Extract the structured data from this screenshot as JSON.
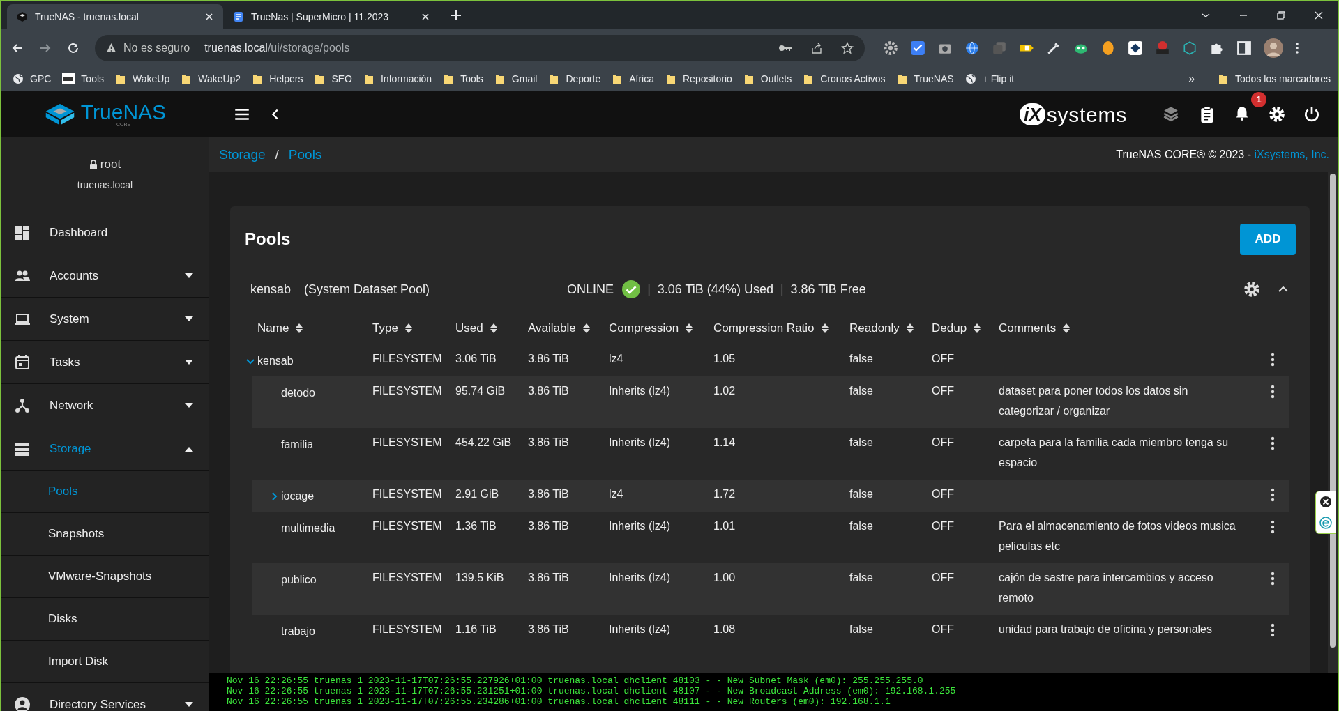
{
  "browser": {
    "tabs": [
      {
        "title": "TrueNAS - truenas.local",
        "selected": true
      },
      {
        "title": "TrueNas | SuperMicro | 11.2023",
        "selected": false
      }
    ],
    "address": {
      "warning": "No es seguro",
      "host": "truenas.local",
      "path": "/ui/storage/pools"
    },
    "bookmarks": [
      {
        "label": "GPC",
        "kind": "globe"
      },
      {
        "label": "Tools",
        "kind": "site"
      },
      {
        "label": "WakeUp",
        "kind": "folder"
      },
      {
        "label": "WakeUp2",
        "kind": "folder"
      },
      {
        "label": "Helpers",
        "kind": "folder"
      },
      {
        "label": "SEO",
        "kind": "folder"
      },
      {
        "label": "Información",
        "kind": "folder"
      },
      {
        "label": "Tools",
        "kind": "folder"
      },
      {
        "label": "Gmail",
        "kind": "folder"
      },
      {
        "label": "Deporte",
        "kind": "folder"
      },
      {
        "label": "Africa",
        "kind": "folder"
      },
      {
        "label": "Repositorio",
        "kind": "folder"
      },
      {
        "label": "Outlets",
        "kind": "folder"
      },
      {
        "label": "Cronos Activos",
        "kind": "folder"
      },
      {
        "label": "TrueNAS",
        "kind": "folder"
      },
      {
        "label": "+ Flip it",
        "kind": "globe"
      }
    ],
    "more_bookmarks": "»",
    "all_bookmarks": "Todos los marcadores"
  },
  "app_header": {
    "logo": "TrueNAS",
    "logo_sub": "CORE",
    "vendor_mark": "iX",
    "vendor_word": "systems",
    "notification_count": "1"
  },
  "sidebar": {
    "user": "root",
    "host": "truenas.local",
    "items": [
      {
        "label": "Dashboard",
        "selected": false
      },
      {
        "label": "Accounts",
        "selected": false,
        "expanded": false
      },
      {
        "label": "System",
        "selected": false,
        "expanded": false
      },
      {
        "label": "Tasks",
        "selected": false,
        "expanded": false
      },
      {
        "label": "Network",
        "selected": false,
        "expanded": false
      },
      {
        "label": "Storage",
        "selected": true,
        "expanded": true,
        "children": [
          {
            "label": "Pools",
            "selected": true
          },
          {
            "label": "Snapshots",
            "selected": false
          },
          {
            "label": "VMware-Snapshots",
            "selected": false
          },
          {
            "label": "Disks",
            "selected": false
          },
          {
            "label": "Import Disk",
            "selected": false
          }
        ]
      },
      {
        "label": "Directory Services",
        "selected": false,
        "expanded": false
      }
    ]
  },
  "breadcrumb": [
    "Storage",
    "Pools"
  ],
  "breadcrumb_separator": "/",
  "footer_credit": {
    "text": "TrueNAS CORE® © 2023 - ",
    "link": "iXsystems, Inc."
  },
  "card": {
    "title": "Pools",
    "add_button": "ADD"
  },
  "pool": {
    "name": "kensab",
    "note": "(System Dataset Pool)",
    "status": "ONLINE",
    "healthy": true,
    "separator": "|",
    "used": "3.06 TiB (44%) Used",
    "separator_2": "|",
    "free": "3.86 TiB Free",
    "expanded": true
  },
  "table": {
    "columns": [
      "Name",
      "Type",
      "Used",
      "Available",
      "Compression",
      "Compression Ratio",
      "Readonly",
      "Dedup",
      "Comments"
    ],
    "rows": [
      {
        "name": "kensab",
        "type": "FILESYSTEM",
        "used": "3.06 TiB",
        "available": "3.86 TiB",
        "compression": "lz4",
        "ratio": "1.05",
        "readonly": "false",
        "dedup": "OFF",
        "expanded": true,
        "children": [
          {
            "name": "detodo",
            "type": "FILESYSTEM",
            "used": "95.74 GiB",
            "available": "3.86 TiB",
            "compression": "Inherits (lz4)",
            "ratio": "1.02",
            "readonly": "false",
            "dedup": "OFF",
            "comments": "dataset para poner todos los datos sin categorizar / organizar"
          },
          {
            "name": "familia",
            "type": "FILESYSTEM",
            "used": "454.22 GiB",
            "available": "3.86 TiB",
            "compression": "Inherits (lz4)",
            "ratio": "1.14",
            "readonly": "false",
            "dedup": "OFF",
            "comments": "carpeta para la familia cada miembro tenga su espacio"
          },
          {
            "name": "iocage",
            "type": "FILESYSTEM",
            "used": "2.91 GiB",
            "available": "3.86 TiB",
            "compression": "lz4",
            "ratio": "1.72",
            "readonly": "false",
            "dedup": "OFF",
            "expanded": false
          },
          {
            "name": "multimedia",
            "type": "FILESYSTEM",
            "used": "1.36 TiB",
            "available": "3.86 TiB",
            "compression": "Inherits (lz4)",
            "ratio": "1.01",
            "readonly": "false",
            "dedup": "OFF",
            "comments": "Para el almacenamiento de fotos videos musica peliculas etc"
          },
          {
            "name": "publico",
            "type": "FILESYSTEM",
            "used": "139.5 KiB",
            "available": "3.86 TiB",
            "compression": "Inherits (lz4)",
            "ratio": "1.00",
            "readonly": "false",
            "dedup": "OFF",
            "comments": "cajón de sastre para intercambios y acceso remoto"
          },
          {
            "name": "trabajo",
            "type": "FILESYSTEM",
            "used": "1.16 TiB",
            "available": "3.86 TiB",
            "compression": "Inherits (lz4)",
            "ratio": "1.08",
            "readonly": "false",
            "dedup": "OFF",
            "comments": "unidad para trabajo de oficina y personales"
          }
        ]
      }
    ]
  },
  "console": [
    "Nov 16 22:26:55 truenas 1 2023-11-17T07:26:55.227926+01:00 truenas.local dhclient 48103 - - New Subnet Mask (em0): 255.255.255.0",
    "Nov 16 22:26:55 truenas 1 2023-11-17T07:26:55.231251+01:00 truenas.local dhclient 48107 - - New Broadcast Address (em0): 192.168.1.255",
    "Nov 16 22:26:55 truenas 1 2023-11-17T07:26:55.234286+01:00 truenas.local dhclient 48111 - - New Routers (em0): 192.168.1.1"
  ]
}
